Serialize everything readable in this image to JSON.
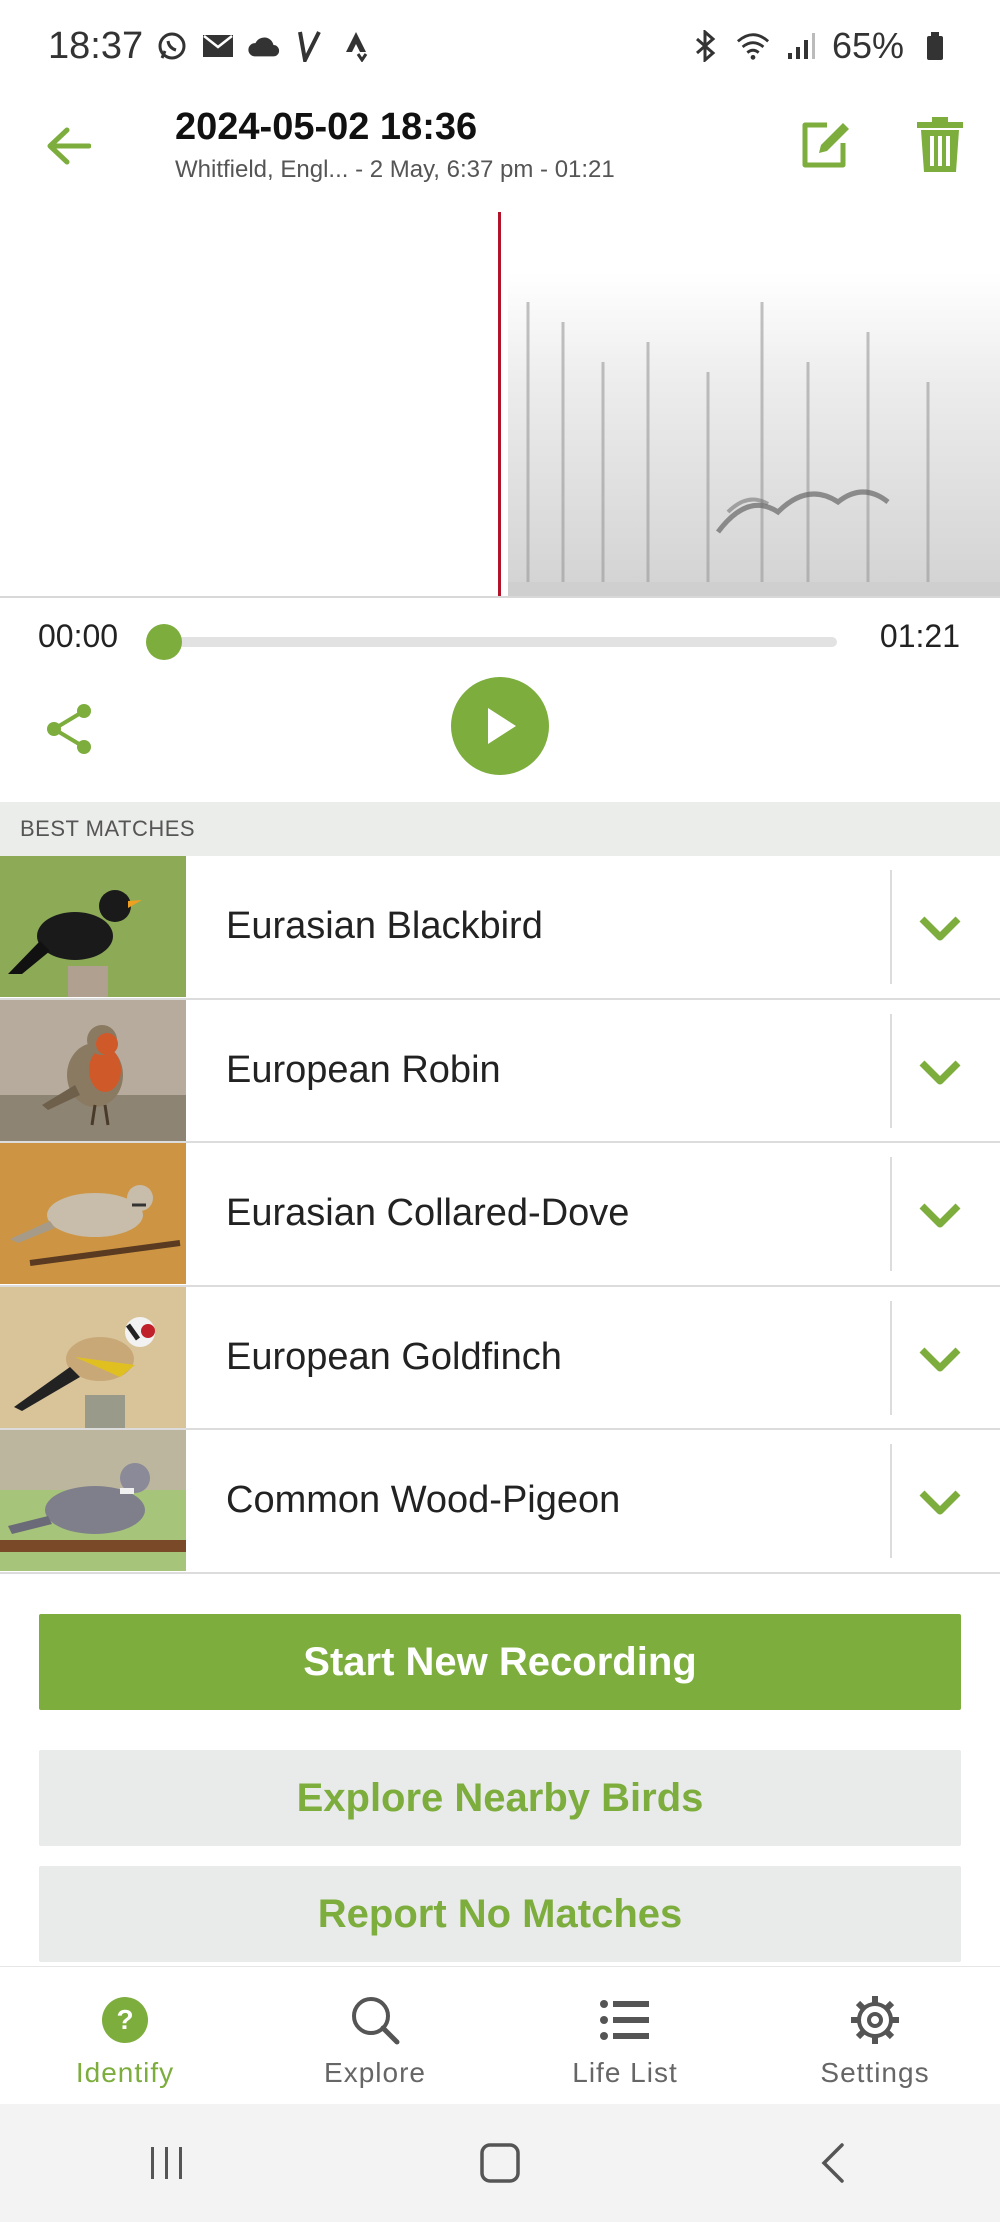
{
  "status_bar": {
    "time": "18:37",
    "battery": "65%",
    "left_icons": [
      "whatsapp-icon",
      "mail-icon",
      "cloud-icon",
      "v-app-icon",
      "strava-icon"
    ],
    "right_icons": [
      "bluetooth-icon",
      "wifi-icon",
      "signal-icon",
      "battery-icon"
    ]
  },
  "header": {
    "title": "2024-05-02 18:36",
    "subtitle": "Whitfield, Engl... - 2 May, 6:37 pm - 01:21"
  },
  "player": {
    "current_time": "00:00",
    "duration": "01:21",
    "progress": 0
  },
  "best_matches": {
    "heading": "BEST MATCHES",
    "items": [
      {
        "name": "Eurasian Blackbird"
      },
      {
        "name": "European Robin"
      },
      {
        "name": "Eurasian Collared-Dove"
      },
      {
        "name": "European Goldfinch"
      },
      {
        "name": "Common Wood-Pigeon"
      }
    ]
  },
  "actions": {
    "start_recording": "Start New Recording",
    "explore_nearby": "Explore Nearby Birds",
    "report_no_matches": "Report No Matches"
  },
  "bottom_nav": {
    "items": [
      {
        "label": "Identify",
        "icon": "identify-icon",
        "active": true
      },
      {
        "label": "Explore",
        "icon": "search-icon",
        "active": false
      },
      {
        "label": "Life List",
        "icon": "list-icon",
        "active": false
      },
      {
        "label": "Settings",
        "icon": "gear-icon",
        "active": false
      }
    ]
  },
  "colors": {
    "accent": "#7cad3d",
    "playhead": "#b3122b",
    "section_bg": "#ebedea"
  }
}
